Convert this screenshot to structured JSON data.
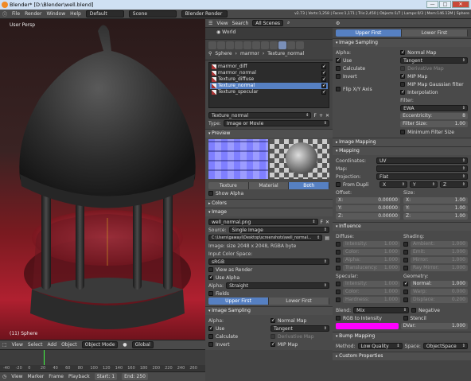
{
  "window": {
    "title": "Blender* [D:\\Blender\\well.blend]",
    "min": "—",
    "max": "□",
    "close": "✕"
  },
  "topbar": {
    "menus": [
      "File",
      "Render",
      "Window",
      "Help"
    ],
    "layout": "Default",
    "scene": "Scene",
    "engine": "Blender Render",
    "stats": "v2.73 | Verts:1,258 | Faces:1,171 | Tris:2,450 | Objects:1/7 | Lamps:0/3 | Mem:146.12M | Sphere"
  },
  "viewport": {
    "label": "User Persp",
    "object": "(11) Sphere",
    "toolbar": [
      "View",
      "Select",
      "Add",
      "Object"
    ],
    "mode": "Object Mode",
    "orientation": "Global"
  },
  "timeline": {
    "ticks": [
      "-40",
      "-20",
      "0",
      "20",
      "40",
      "60",
      "80",
      "100",
      "120",
      "140",
      "160",
      "180",
      "200",
      "220",
      "240",
      "260"
    ]
  },
  "bottombar": {
    "menus": [
      "View",
      "Marker",
      "Frame",
      "Playback"
    ],
    "start_label": "Start:",
    "start": "1",
    "end_label": "End:",
    "end": "250"
  },
  "outliner": {
    "menus": [
      "View",
      "Search"
    ],
    "scenes": "All Scenes",
    "world": "World"
  },
  "breadcrumb": [
    "Sphere",
    "marmor",
    "Texture_normal"
  ],
  "texture_list": {
    "items": [
      "marmor_diff",
      "marmor_normal",
      "Texture_diffuse",
      "Texture_normal",
      "Texture_specular"
    ],
    "selected": 3,
    "checked": [
      true,
      true,
      true,
      true,
      true
    ]
  },
  "texture": {
    "name": "Texture_normal",
    "type_label": "Type:",
    "type": "Image or Movie"
  },
  "preview": {
    "title": "Preview",
    "tabs": [
      "Texture",
      "Material",
      "Both"
    ],
    "active": 2,
    "show_alpha": "Show Alpha"
  },
  "colors": {
    "title": "Colors"
  },
  "image": {
    "title": "Image",
    "file": "well_normal.png",
    "source_label": "Source:",
    "source": "Single Image",
    "path": "C:\\Users\\gawayl\\Desktop\\screenshots\\well_normal...",
    "info": "Image: size 2048 x 2048, RGBA byte",
    "colorspace_label": "Input Color Space:",
    "colorspace": "sRGB",
    "view_as_render": "View as Render",
    "use_alpha": "Use Alpha",
    "alpha_label": "Alpha:",
    "alpha": "Straight",
    "fields": "Fields",
    "field_tabs": [
      "Upper First",
      "Lower First"
    ]
  },
  "image_sampling_mid": {
    "title": "Image Sampling",
    "alpha_label": "Alpha:",
    "use": "Use",
    "calculate": "Calculate",
    "invert": "Invert",
    "normal_map": "Normal Map",
    "space": "Tangent",
    "derivative_map": "Derivative Map",
    "mip_map": "MIP Map"
  },
  "right": {
    "field_tabs": [
      "Upper First",
      "Lower First"
    ],
    "image_sampling": {
      "title": "Image Sampling",
      "alpha_label": "Alpha:",
      "use": "Use",
      "calculate": "Calculate",
      "invert": "Invert",
      "flip": "Flip X/Y Axis",
      "normal_map": "Normal Map",
      "space": "Tangent",
      "derivative_map": "Derivative Map",
      "mip_map": "MIP Map",
      "mip_gauss": "MIP Map Gaussian filter",
      "interpolation": "Interpolation",
      "filter_label": "Filter:",
      "filter": "EWA",
      "eccentricity_label": "Eccentricity:",
      "eccentricity": "8",
      "filter_size_label": "Filter Size:",
      "filter_size": "1.00",
      "min_filter": "Minimum Filter Size"
    },
    "image_mapping": {
      "title": "Image Mapping"
    },
    "mapping": {
      "title": "Mapping",
      "coordinates_label": "Coordinates:",
      "coordinates": "UV",
      "map_label": "Map:",
      "projection_label": "Projection:",
      "projection": "Flat",
      "from_dupli": "From Dupli",
      "axes": [
        "X",
        "Y",
        "Z"
      ],
      "offset_label": "Offset:",
      "size_label": "Size:",
      "offset": [
        {
          "k": "X:",
          "v": "0.00000"
        },
        {
          "k": "Y:",
          "v": "0.00000"
        },
        {
          "k": "Z:",
          "v": "0.00000"
        }
      ],
      "size": [
        {
          "k": "X:",
          "v": "1.00"
        },
        {
          "k": "Y:",
          "v": "1.00"
        },
        {
          "k": "Z:",
          "v": "1.00"
        }
      ]
    },
    "influence": {
      "title": "Influence",
      "diffuse_label": "Diffuse:",
      "shading_label": "Shading:",
      "diffuse": [
        {
          "k": "Intensity:",
          "v": "1.000"
        },
        {
          "k": "Color:",
          "v": "1.000"
        },
        {
          "k": "Alpha:",
          "v": "1.000"
        },
        {
          "k": "Translucency:",
          "v": "1.000"
        }
      ],
      "shading": [
        {
          "k": "Ambient:",
          "v": "1.000"
        },
        {
          "k": "Emit:",
          "v": "1.000"
        },
        {
          "k": "Mirror:",
          "v": "1.000"
        },
        {
          "k": "Ray Mirror:",
          "v": "1.000"
        }
      ],
      "specular_label": "Specular:",
      "geometry_label": "Geometry:",
      "specular": [
        {
          "k": "Intensity:",
          "v": "1.000"
        },
        {
          "k": "Color:",
          "v": "1.000"
        },
        {
          "k": "Hardness:",
          "v": "1.000"
        }
      ],
      "geometry": [
        {
          "k": "Normal:",
          "v": "1.000"
        },
        {
          "k": "Warp:",
          "v": "0.000"
        },
        {
          "k": "Displace:",
          "v": "0.200"
        }
      ],
      "blend_label": "Blend:",
      "blend": "Mix",
      "negative": "Negative",
      "rgb_intensity": "RGB to Intensity",
      "stencil": "Stencil",
      "dvar_label": "DVar:",
      "dvar": "1.000",
      "color": "#ff00ff"
    },
    "bump": {
      "title": "Bump Mapping",
      "method_label": "Method:",
      "method": "Low Quality",
      "space_label": "Space:",
      "space": "ObjectSpace"
    },
    "custom": {
      "title": "Custom Properties"
    }
  }
}
